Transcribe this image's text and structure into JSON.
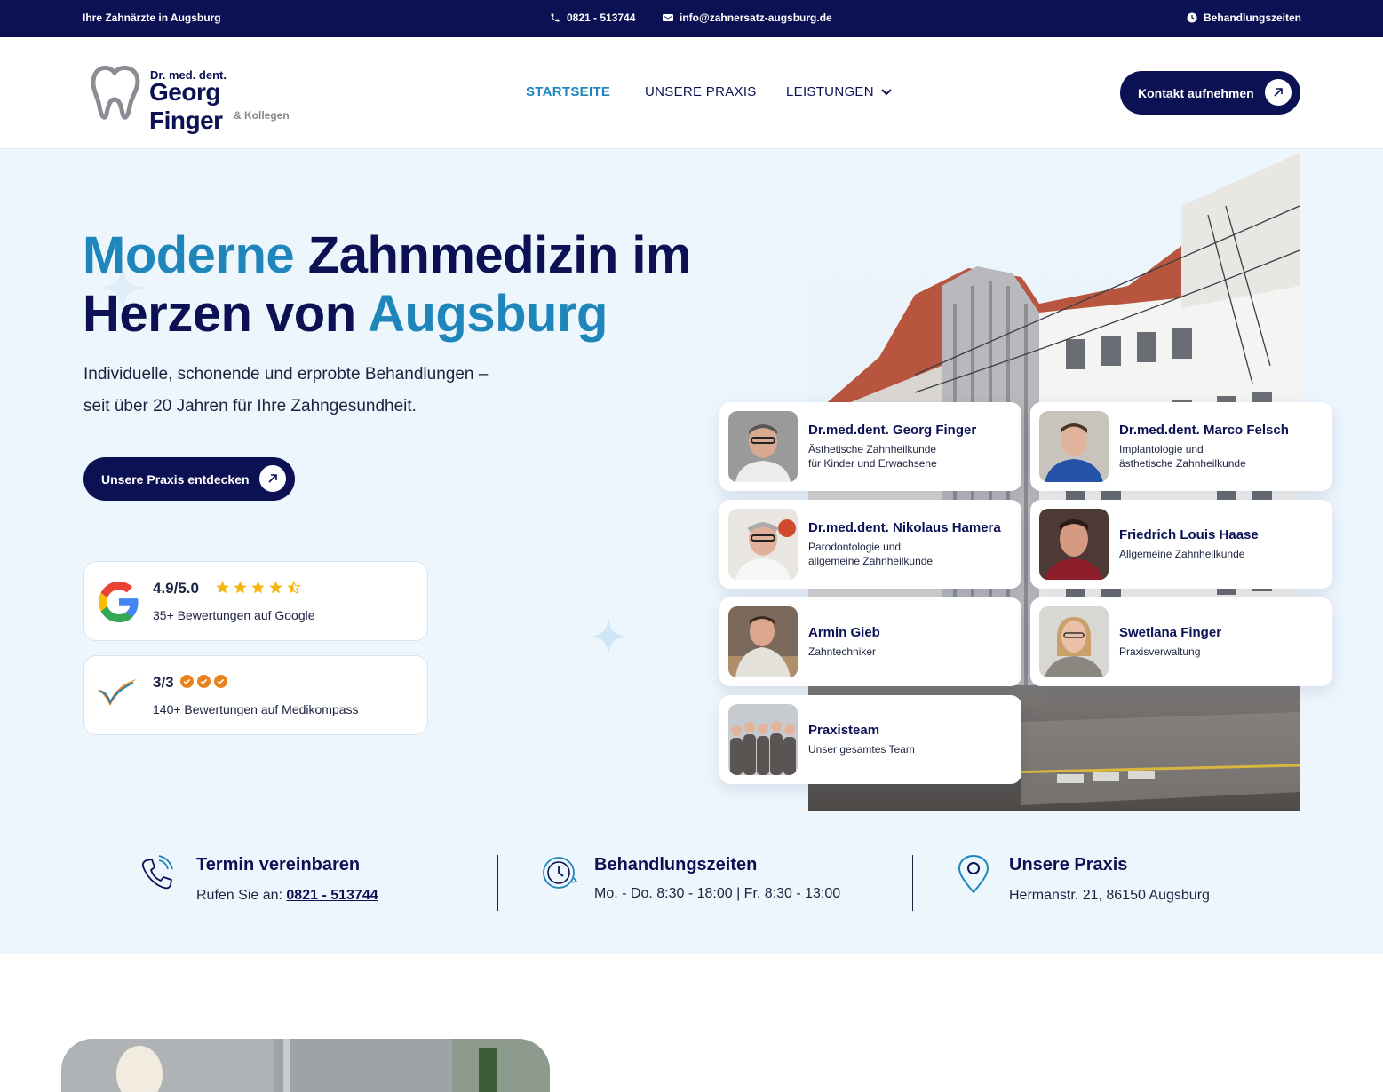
{
  "topbar": {
    "tagline": "Ihre Zahnärzte in Augsburg",
    "phone": "0821 - 513744",
    "email": "info@zahnersatz-augsburg.de",
    "hours_link": "Behandlungszeiten"
  },
  "logo": {
    "line1": "Dr. med. dent.",
    "line2": "Georg Finger",
    "line3": "& Kollegen"
  },
  "nav": {
    "items": [
      {
        "label": "STARTSEITE",
        "active": true
      },
      {
        "label": "UNSERE PRAXIS",
        "active": false
      },
      {
        "label": "LEISTUNGEN",
        "active": false
      }
    ],
    "cta": "Kontakt aufnehmen"
  },
  "hero": {
    "title_part1": "Moderne",
    "title_part2": " Zahnmedizin im",
    "title_part3": "Herzen von ",
    "title_part4": "Augsburg",
    "subtitle_line1": "Individuelle, schonende und erprobte Behandlungen –",
    "subtitle_line2": "seit über 20 Jahren für Ihre Zahngesundheit.",
    "cta": "Unsere Praxis entdecken"
  },
  "ratings": {
    "google": {
      "score": "4.9/5.0",
      "text": "35+ Bewertungen auf Google",
      "stars": 4.5
    },
    "medikompass": {
      "score": "3/3",
      "text": "140+ Bewertungen auf Medikompass"
    }
  },
  "team": [
    {
      "name": "Dr.med.dent. Georg Finger",
      "role": "Ästhetische Zahnheilkunde\nfür Kinder und Erwachsene"
    },
    {
      "name": "Dr.med.dent. Marco Felsch",
      "role": "Implantologie und\nästhetische Zahnheilkunde"
    },
    {
      "name": "Dr.med.dent. Nikolaus Hamera",
      "role": "Parodontologie und\nallgemeine Zahnheilkunde"
    },
    {
      "name": "Friedrich Louis Haase",
      "role": "Allgemeine Zahnheilkunde"
    },
    {
      "name": "Armin Gieb",
      "role": "Zahntechniker"
    },
    {
      "name": "Swetlana Finger",
      "role": "Praxisverwaltung"
    },
    {
      "name": "Praxisteam",
      "role": "Unser gesamtes Team"
    }
  ],
  "infobar": {
    "appointment": {
      "title": "Termin vereinbaren",
      "prefix": "Rufen Sie an: ",
      "phone": "0821 - 513744"
    },
    "hours": {
      "title": "Behandlungszeiten",
      "text": "Mo. - Do. 8:30 - 18:00 | Fr. 8:30 - 13:00"
    },
    "location": {
      "title": "Unsere Praxis",
      "address": "Hermanstr. 21, 86150 Augsburg"
    }
  },
  "colors": {
    "navy": "#0b1153",
    "accent": "#1e86bb",
    "hero_bg": "#eef6fd",
    "star": "#f6b60e",
    "medi_orange": "#e8821e"
  }
}
